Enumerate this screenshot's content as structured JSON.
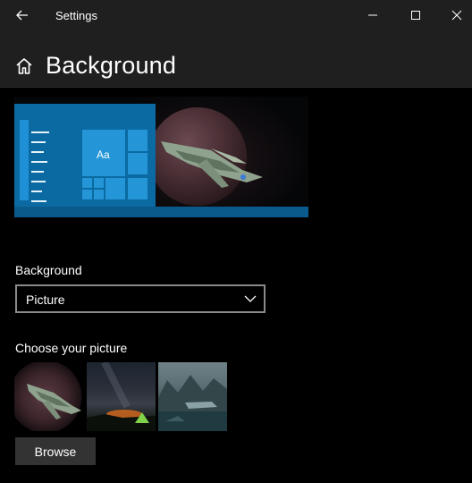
{
  "window": {
    "title": "Settings"
  },
  "header": {
    "page_title": "Background"
  },
  "preview": {
    "tile_text": "Aa"
  },
  "background_setting": {
    "label": "Background",
    "selected": "Picture"
  },
  "pictures": {
    "label": "Choose your picture",
    "items": [
      {
        "name": "spaceship-planet"
      },
      {
        "name": "night-sky-tent"
      },
      {
        "name": "mountain-lake-ship"
      }
    ]
  },
  "browse_button": {
    "label": "Browse"
  },
  "colors": {
    "accent": "#0b6aa2",
    "titlebar": "#1f1f1f",
    "background": "#000000",
    "button": "#333333"
  }
}
